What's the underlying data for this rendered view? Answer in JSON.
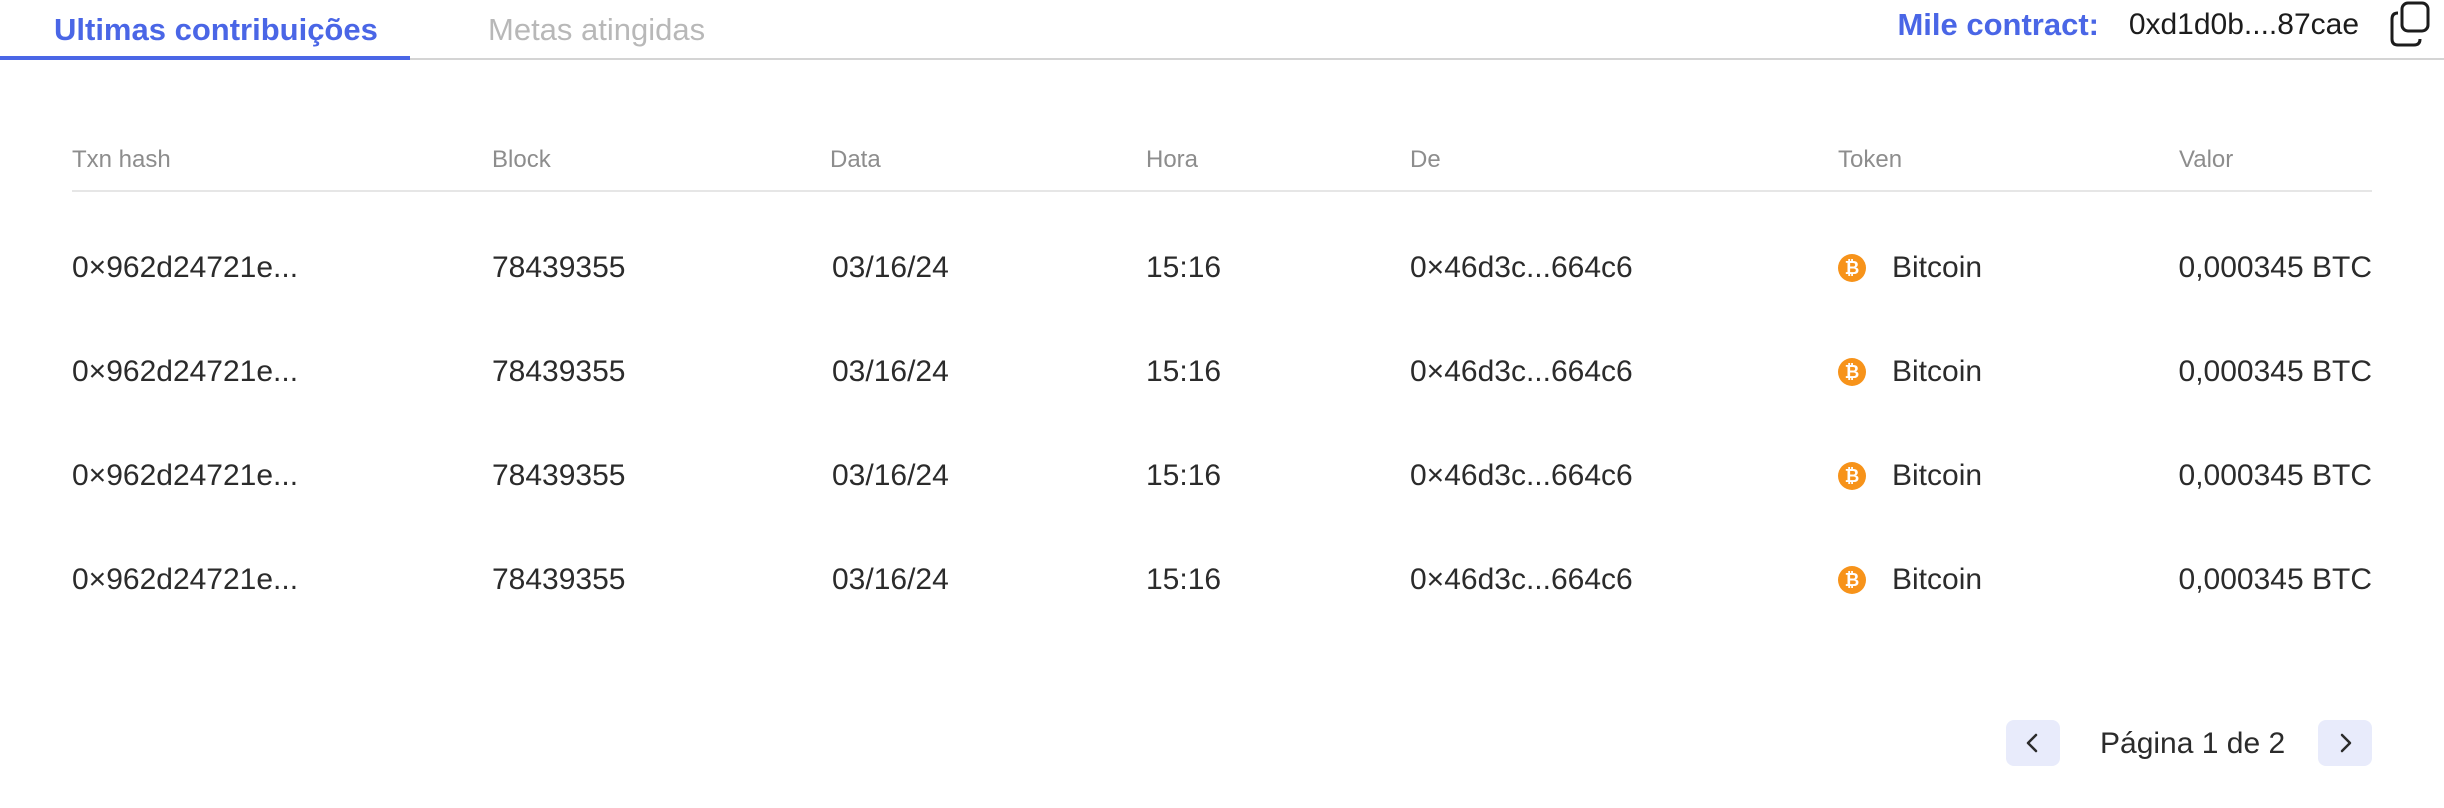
{
  "tabs": [
    {
      "label": "Ultimas contribuições",
      "active": true
    },
    {
      "label": "Metas atingidas",
      "active": false
    }
  ],
  "contract": {
    "label": "Mile contract:",
    "address": "0xd1d0b....87cae"
  },
  "table": {
    "headers": [
      "Txn hash",
      "Block",
      "Data",
      "Hora",
      "De",
      "Token",
      "Valor"
    ],
    "rows": [
      {
        "hash": "0×962d24721e...",
        "block": "78439355",
        "date": "03/16/24",
        "time": "15:16",
        "from": "0×46d3c...664c6",
        "token": "Bitcoin",
        "value": "0,000345 BTC"
      },
      {
        "hash": "0×962d24721e...",
        "block": "78439355",
        "date": "03/16/24",
        "time": "15:16",
        "from": "0×46d3c...664c6",
        "token": "Bitcoin",
        "value": "0,000345 BTC"
      },
      {
        "hash": "0×962d24721e...",
        "block": "78439355",
        "date": "03/16/24",
        "time": "15:16",
        "from": "0×46d3c...664c6",
        "token": "Bitcoin",
        "value": "0,000345 BTC"
      },
      {
        "hash": "0×962d24721e...",
        "block": "78439355",
        "date": "03/16/24",
        "time": "15:16",
        "from": "0×46d3c...664c6",
        "token": "Bitcoin",
        "value": "0,000345 BTC"
      }
    ]
  },
  "pagination": {
    "label": "Página 1 de 2"
  },
  "icons": {
    "token": "bitcoin-icon",
    "copy": "copy-icon",
    "prev": "chevron-left-icon",
    "next": "chevron-right-icon"
  },
  "colors": {
    "accent": "#4a66e6",
    "bitcoin": "#f7931a",
    "pager_bg": "#e8ebfb"
  }
}
